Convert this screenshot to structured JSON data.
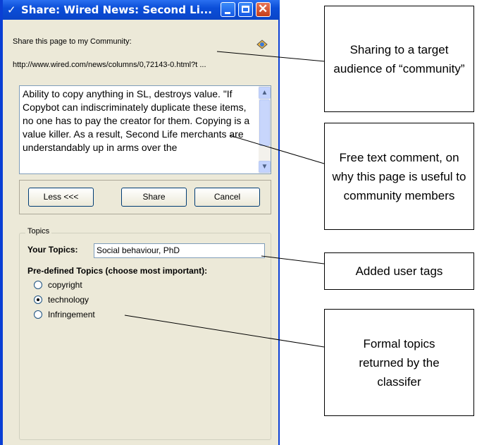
{
  "window": {
    "title": "Share: Wired News: Second Li...",
    "share_label": "Share this page to my Community:",
    "url": "http://www.wired.com/news/columns/0,72143-0.html?t ...",
    "comment": "Ability to copy anything in SL, destroys value. \"If Copybot can indiscriminately duplicate these items, no one has to pay the creator for them. Copying is a value killer. As a result, Second Life merchants are understandably up in arms over the",
    "buttons": {
      "less": "Less <<<",
      "share": "Share",
      "cancel": "Cancel"
    },
    "topics": {
      "legend": "Topics",
      "your_topics_label": "Your Topics:",
      "your_topics_value": "Social behaviour, PhD",
      "predefined_label": "Pre-defined Topics (choose most important):",
      "options": [
        "copyright",
        "technology",
        "Infringement"
      ],
      "selected": "technology"
    }
  },
  "annotations": [
    "Sharing to a target audience of “community”",
    "Free text comment, on why this page is useful to community members",
    "Added user tags",
    "Formal topics returned by the classifer"
  ]
}
